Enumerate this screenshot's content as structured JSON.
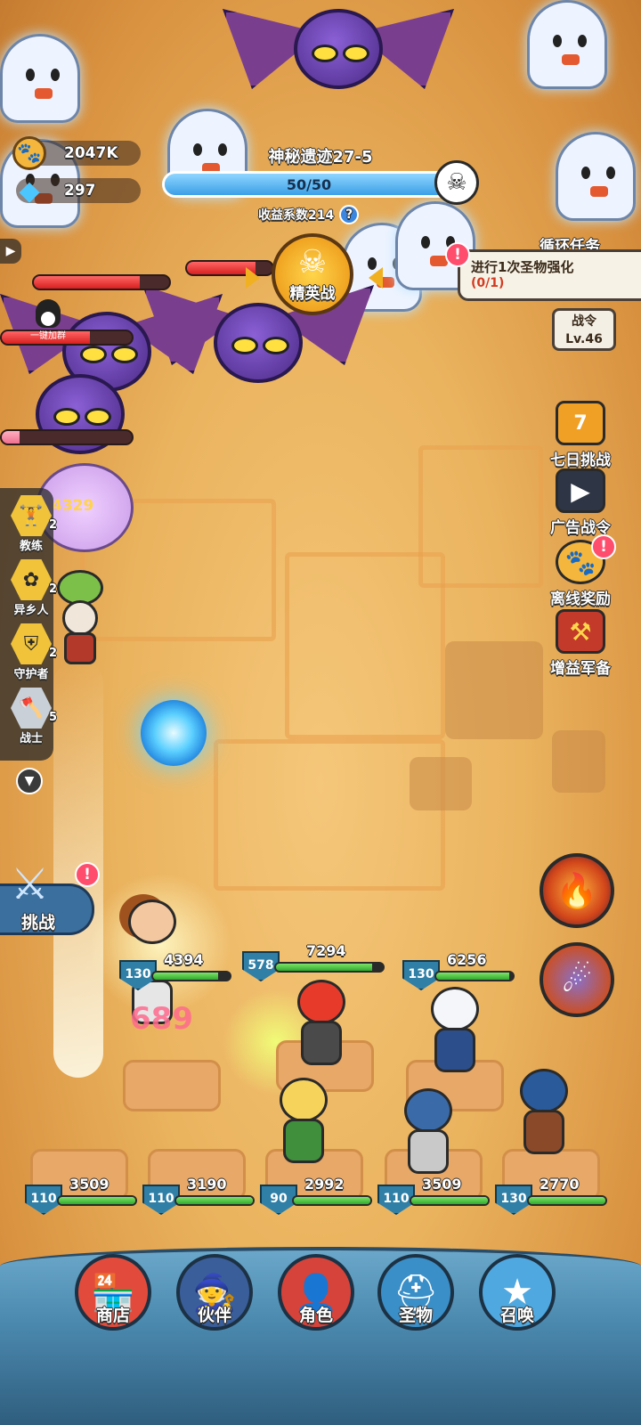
{
  "currency": {
    "coins": "2047K",
    "gems": "297"
  },
  "stage": {
    "title": "神秘遗迹27-5",
    "progress_text": "50/50",
    "progress_fraction": 1.0,
    "income_coefficient": "收益系数214",
    "help": "?"
  },
  "elite_battle": {
    "label": "精英战"
  },
  "quest": {
    "title": "循环任务",
    "description": "进行1次圣物强化",
    "progress": "(0/1)",
    "alert": "!"
  },
  "battle_pass": {
    "line1": "战令",
    "line2": "Lv.46"
  },
  "side_menu": [
    {
      "label": "七日挑战",
      "icon": "seven-day-medal-icon",
      "badge": "7"
    },
    {
      "label": "广告战令",
      "icon": "video-play-icon"
    },
    {
      "label": "离线奖励",
      "icon": "paw-coin-icon",
      "alert": "!"
    },
    {
      "label": "增益军备",
      "icon": "weapon-chest-icon"
    }
  ],
  "qq_group": {
    "label": "一键加群"
  },
  "enemy_damage": "4329",
  "jobs": [
    {
      "label": "教练",
      "count": "2",
      "icon": "dumbbell-icon"
    },
    {
      "label": "异乡人",
      "count": "2",
      "icon": "flower-icon"
    },
    {
      "label": "守护者",
      "count": "2",
      "icon": "shield-icon"
    },
    {
      "label": "战士",
      "count": "5",
      "icon": "axe-icon"
    }
  ],
  "challenge": {
    "label": "挑战",
    "alert": "!"
  },
  "front_heroes": [
    {
      "level": "130",
      "hp": "4394",
      "hp_fraction": 0.85
    },
    {
      "level": "578",
      "hp": "7294",
      "hp_fraction": 0.9
    },
    {
      "level": "130",
      "hp": "6256",
      "hp_fraction": 0.95
    }
  ],
  "back_heroes": [
    {
      "level": "110",
      "hp": "3509",
      "hp_fraction": 1.0
    },
    {
      "level": "110",
      "hp": "3190",
      "hp_fraction": 1.0
    },
    {
      "level": "90",
      "hp": "2992",
      "hp_fraction": 1.0
    },
    {
      "level": "110",
      "hp": "3509",
      "hp_fraction": 1.0
    },
    {
      "level": "130",
      "hp": "2770",
      "hp_fraction": 1.0
    }
  ],
  "floating_damage": "689",
  "nav": [
    {
      "label": "商店",
      "icon": "shop-icon"
    },
    {
      "label": "伙伴",
      "icon": "wizard-hat-icon"
    },
    {
      "label": "角色",
      "icon": "hero-face-icon"
    },
    {
      "label": "圣物",
      "icon": "relic-helmet-icon"
    },
    {
      "label": "召唤",
      "icon": "summon-orb-icon"
    }
  ],
  "colors": {
    "ground": "#eab35e",
    "hp_green": "#2faa2c",
    "enemy_hp_red": "#d82020",
    "stage_bar_blue": "#3b9fe6",
    "nav_blue": "#4c8ab0"
  }
}
